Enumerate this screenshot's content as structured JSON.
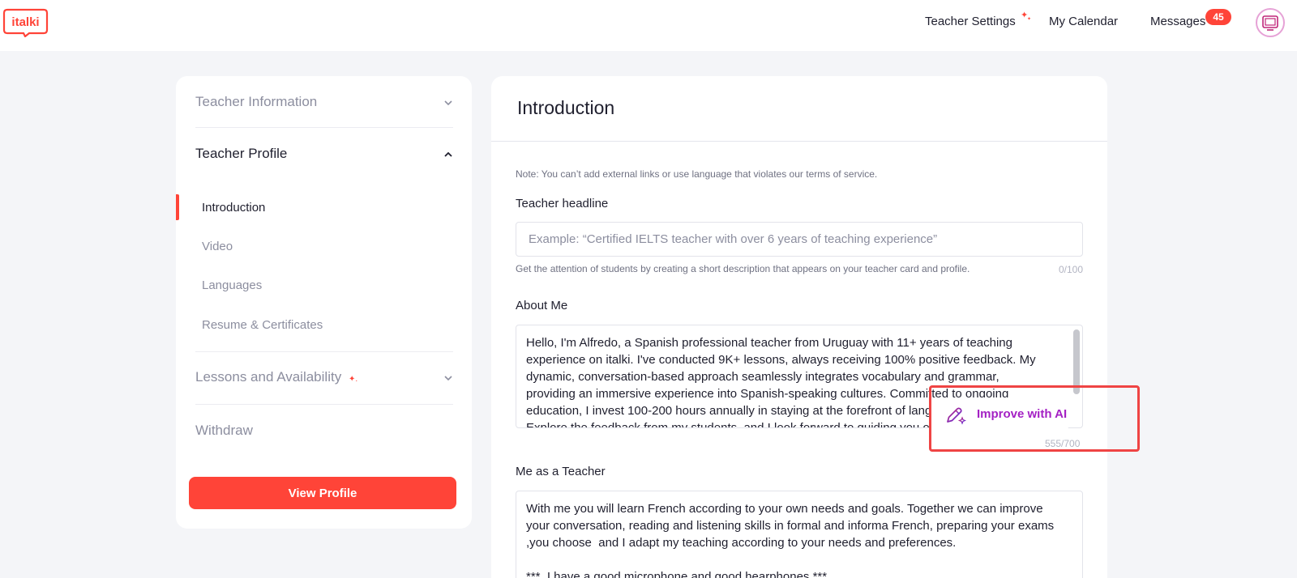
{
  "header": {
    "logo_text": "italki",
    "nav": {
      "teacher_settings": "Teacher Settings",
      "my_calendar": "My Calendar",
      "messages": "Messages",
      "messages_badge": "45"
    },
    "sparkle_icon": "sparkle-icon"
  },
  "sidebar": {
    "sections": [
      {
        "label": "Teacher Information",
        "expanded": false
      },
      {
        "label": "Teacher Profile",
        "expanded": true
      },
      {
        "label": "Lessons and Availability",
        "expanded": false
      },
      {
        "label": "Withdraw"
      }
    ],
    "profile_items": [
      {
        "label": "Introduction",
        "active": true
      },
      {
        "label": "Video"
      },
      {
        "label": "Languages"
      },
      {
        "label": "Resume & Certificates"
      }
    ],
    "view_profile_label": "View Profile"
  },
  "main": {
    "title": "Introduction",
    "note": "Note: You can’t add external links or use language that violates our terms of service.",
    "headline": {
      "label": "Teacher headline",
      "value": "",
      "placeholder": "Example: “Certified IELTS teacher with over 6 years of teaching experience”",
      "hint": "Get the attention of students by creating a short description that appears on your teacher card and profile.",
      "counter": "0/100"
    },
    "about": {
      "label": "About Me",
      "text": "Hello, I'm Alfredo, a Spanish professional teacher from Uruguay with 11+ years of teaching\nexperience on italki. I've conducted 9K+ lessons, always receiving 100% positive feedback. My\ndynamic, conversation-based approach seamlessly integrates vocabulary and grammar,\nproviding an immersive experience into Spanish-speaking cultures. Committed to ongoing\neducation, I invest 100-200 hours annually in staying at the forefront of langu\nExplore the feedback from my students, and I look forward to guiding you on your Spanish",
      "counter": "555/700",
      "ai_button_label": "Improve with AI"
    },
    "teacher": {
      "label": "Me as a Teacher",
      "text": "With me you will learn French according to your own needs and goals. Together we can improve\nyour conversation, reading and listening skills in formal and informa French, preparing your exams\n,you choose  and I adapt my teaching according to your needs and preferences.\n\n***  I have a good microphone and good hearphones ***"
    }
  },
  "colors": {
    "brand": "#ff4438",
    "ai_gradient_start": "#c0267a",
    "ai_gradient_end": "#5b2be0",
    "highlight": "#ef4444"
  }
}
